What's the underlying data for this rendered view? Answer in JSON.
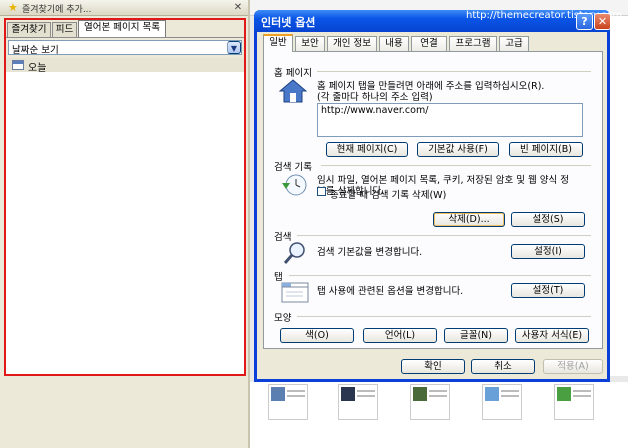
{
  "pane": {
    "header_title": "즐겨찾기에 추가...",
    "tabs": [
      "즐겨찾기",
      "피드",
      "열어본 페이지 목록"
    ],
    "view_select": "날짜순 보기",
    "history_items": [
      "오늘"
    ]
  },
  "dialog": {
    "title": "인터넷 옵션",
    "watermark": "http://themecreator.tistory.com",
    "help": "?",
    "close": "✕",
    "tabs": [
      "일반",
      "보안",
      "개인 정보",
      "내용",
      "연결",
      "프로그램",
      "고급"
    ],
    "homepage": {
      "heading": "홈 페이지",
      "desc1": "홈 페이지 탭을 만들려면 아래에 주소를 입력하십시오(R).",
      "desc2": "(각 줄마다 하나의 주소 입력)",
      "url": "http://www.naver.com/",
      "buttons": [
        "현재 페이지(C)",
        "기본값 사용(F)",
        "빈 페이지(B)"
      ]
    },
    "history": {
      "heading": "검색 기록",
      "desc1": "임시 파일, 열어본 페이지 목록, 쿠키, 저장된 암호 및 웹 양식 정",
      "desc2": "보를 삭제합니다.",
      "checkbox": "종료할 때 검색 기록 삭제(W)",
      "delete_btn": "삭제(D)...",
      "settings_btn": "설정(S)"
    },
    "search": {
      "heading": "검색",
      "desc": "검색 기본값을 변경합니다.",
      "settings_btn": "설정(I)"
    },
    "tabsec": {
      "heading": "탭",
      "desc": "탭 사용에 관련된 옵션을 변경합니다.",
      "settings_btn": "설정(T)"
    },
    "appearance": {
      "heading": "모양",
      "buttons": [
        "색(O)",
        "언어(L)",
        "글꼴(N)",
        "사용자 서식(E)"
      ]
    },
    "footer": {
      "ok": "확인",
      "cancel": "취소",
      "apply": "적용(A)"
    }
  },
  "colors": {
    "title_blue": "#0a54e6",
    "annotation_red": "#e01818",
    "pane_bg": "#ece9d8"
  }
}
